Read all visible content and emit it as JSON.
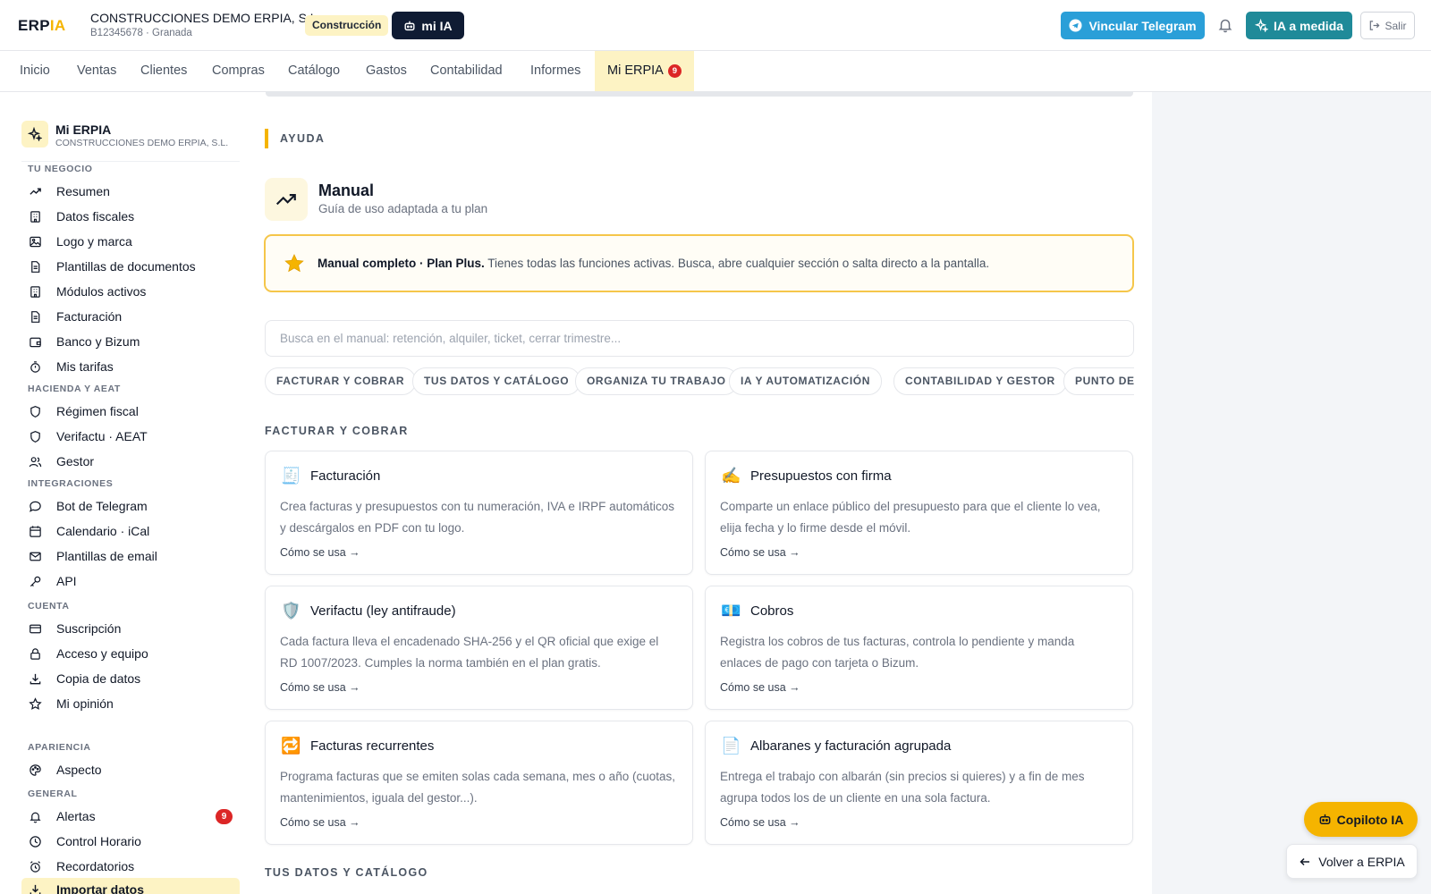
{
  "header": {
    "logo_main": "ERP",
    "logo_accent": "IA",
    "company_name": "CONSTRUCCIONES DEMO ERPIA, S.L.",
    "company_meta": "B12345678 · Granada",
    "sector_badge": "Construcción",
    "mia_label": "mi IA",
    "telegram_label": "Vincular Telegram",
    "ia_label": "IA a medida",
    "salir_label": "Salir"
  },
  "nav": {
    "tabs": [
      "Inicio",
      "Ventas",
      "Clientes",
      "Compras",
      "Catálogo",
      "Gastos",
      "Contabilidad",
      "Informes"
    ],
    "active_label": "Mi ERPIA",
    "active_count": "9"
  },
  "sidebar": {
    "title": "Mi ERPIA",
    "subtitle": "CONSTRUCCIONES DEMO ERPIA, S.L.",
    "sections": [
      "TU NEGOCIO",
      "HACIENDA Y AEAT",
      "INTEGRACIONES",
      "CUENTA",
      "APARIENCIA",
      "GENERAL"
    ],
    "items": [
      {
        "label": "Resumen",
        "icon": "trend-icon"
      },
      {
        "label": "Datos fiscales",
        "icon": "building-icon"
      },
      {
        "label": "Logo y marca",
        "icon": "image-icon"
      },
      {
        "label": "Plantillas de documentos",
        "icon": "document-icon"
      },
      {
        "label": "Módulos activos",
        "icon": "building-icon"
      },
      {
        "label": "Facturación",
        "icon": "document-icon"
      },
      {
        "label": "Banco y Bizum",
        "icon": "wallet-icon"
      },
      {
        "label": "Mis tarifas",
        "icon": "timer-icon"
      },
      {
        "label": "Régimen fiscal",
        "icon": "shield-icon"
      },
      {
        "label": "Verifactu · AEAT",
        "icon": "shield-icon"
      },
      {
        "label": "Gestor",
        "icon": "users-icon"
      },
      {
        "label": "Bot de Telegram",
        "icon": "chat-icon"
      },
      {
        "label": "Calendario · iCal",
        "icon": "calendar-icon"
      },
      {
        "label": "Plantillas de email",
        "icon": "mail-icon"
      },
      {
        "label": "API",
        "icon": "key-icon"
      },
      {
        "label": "Suscripción",
        "icon": "card-icon"
      },
      {
        "label": "Acceso y equipo",
        "icon": "lock-icon"
      },
      {
        "label": "Copia de datos",
        "icon": "download-icon"
      },
      {
        "label": "Mi opinión",
        "icon": "star-icon"
      },
      {
        "label": "Aspecto",
        "icon": "palette-icon"
      },
      {
        "label": "Alertas",
        "icon": "bell-icon",
        "badge": "9"
      },
      {
        "label": "Control Horario",
        "icon": "clock-icon"
      },
      {
        "label": "Recordatorios",
        "icon": "alarm-icon"
      },
      {
        "label": "Importar datos",
        "icon": "download-icon"
      }
    ]
  },
  "help": {
    "section_label": "AYUDA",
    "manual_title": "Manual",
    "manual_subtitle": "Guía de uso adaptada a tu plan",
    "plan_bold": "Manual completo · Plan Plus.",
    "plan_text": " Tienes todas las funciones activas. Busca, abre cualquier sección o salta directo a la pantalla.",
    "search_placeholder": "Busca en el manual: retención, alquiler, ticket, cerrar trimestre...",
    "chips": [
      "FACTURAR Y COBRAR",
      "TUS DATOS Y CATÁLOGO",
      "ORGANIZA TU TRABAJO",
      "IA Y AUTOMATIZACIÓN",
      "CONTABILIDAD Y GESTOR",
      "PUNTO DE"
    ]
  },
  "categories": [
    {
      "label": "FACTURAR Y COBRAR",
      "cards": [
        {
          "emoji": "🧾",
          "title": "Facturación",
          "desc": "Crea facturas y presupuestos con tu numeración, IVA e IRPF automáticos y descárgalos en PDF con tu logo.",
          "link": "Cómo se usa →"
        },
        {
          "emoji": "✍️",
          "title": "Presupuestos con firma",
          "desc": "Comparte un enlace público del presupuesto para que el cliente lo vea, elija fecha y lo firme desde el móvil.",
          "link": "Cómo se usa →"
        },
        {
          "emoji": "🛡️",
          "title": "Verifactu (ley antifraude)",
          "desc": "Cada factura lleva el encadenado SHA-256 y el QR oficial que exige el RD 1007/2023. Cumples la norma también en el plan gratis.",
          "link": "Cómo se usa →"
        },
        {
          "emoji": "💶",
          "title": "Cobros",
          "desc": "Registra los cobros de tus facturas, controla lo pendiente y manda enlaces de pago con tarjeta o Bizum.",
          "link": "Cómo se usa →"
        },
        {
          "emoji": "🔁",
          "title": "Facturas recurrentes",
          "desc": "Programa facturas que se emiten solas cada semana, mes o año (cuotas, mantenimientos, iguala del gestor...).",
          "link": "Cómo se usa →"
        },
        {
          "emoji": "📄",
          "title": "Albaranes y facturación agrupada",
          "desc": "Entrega el trabajo con albarán (sin precios si quieres) y a fin de mes agrupa todos los de un cliente en una sola factura.",
          "link": "Cómo se usa →"
        }
      ]
    },
    {
      "label": "TUS DATOS Y CATÁLOGO",
      "cards": []
    }
  ],
  "floating": {
    "copilot_label": "Copiloto IA",
    "volver_label": "Volver a ERPIA"
  },
  "colors": {
    "accent": "#f5b400",
    "accent_soft": "#fdf3c4",
    "telegram": "#2a9fd8",
    "ia": "#1f8a99",
    "dark": "#0f1b33",
    "badge": "#dc2626"
  }
}
